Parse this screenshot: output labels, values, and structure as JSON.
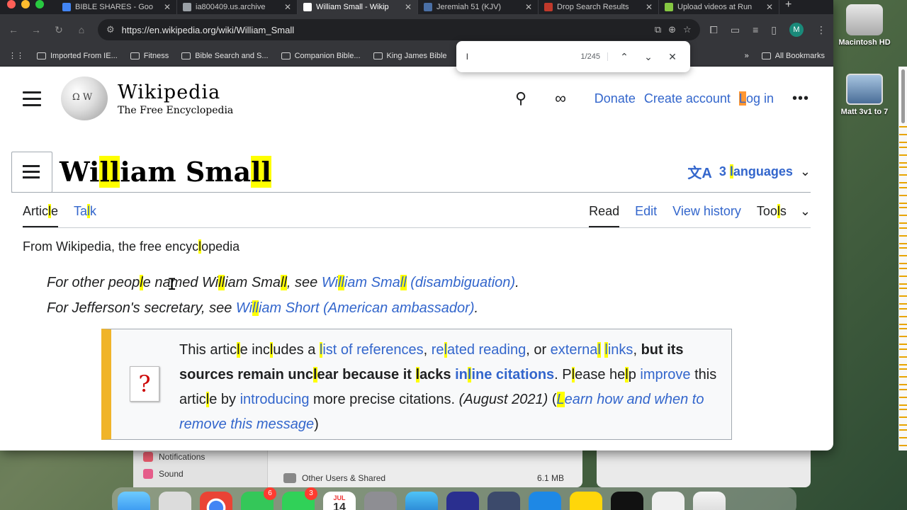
{
  "tabs": [
    {
      "title": "BIBLE SHARES - Goo",
      "favicon_color": "#4285f4",
      "active": false
    },
    {
      "title": "ia800409.us.archive",
      "favicon_color": "#9aa0a6",
      "active": false
    },
    {
      "title": "William Small - Wikip",
      "favicon_color": "#ffffff",
      "active": true
    },
    {
      "title": "Jeremiah 51 (KJV)",
      "favicon_color": "#4a6fa5",
      "active": false
    },
    {
      "title": "Drop Search Results",
      "favicon_color": "#c0392b",
      "active": false
    },
    {
      "title": "Upload videos at Run",
      "favicon_color": "#85c742",
      "active": false
    }
  ],
  "toolbar": {
    "url": "https://en.wikipedia.org/wiki/William_Small",
    "avatar": "M"
  },
  "bookmarks": {
    "items": [
      "Imported From IE...",
      "Fitness",
      "Bible Search and S...",
      "Companion Bible...",
      "King James Bible"
    ],
    "all": "All Bookmarks",
    "more": "»"
  },
  "find": {
    "query": "l",
    "count": "1/245"
  },
  "wiki": {
    "wordmark": "Wikipedia",
    "tagline_logo": "The Free Encyclopedia",
    "donate": "Donate",
    "create_account": "Create account",
    "login_first": "L",
    "login_rest": "og in",
    "title_parts": [
      "Wi",
      "ll",
      "iam Sma",
      "ll"
    ],
    "languages_count": "3 ",
    "languages_l": "l",
    "languages_rest": "anguages",
    "tabs": {
      "article_a": "Artic",
      "article_b": "l",
      "article_c": "e",
      "talk_a": "Ta",
      "talk_b": "l",
      "talk_c": "k",
      "read": "Read",
      "edit": "Edit",
      "history": "View history",
      "tools_a": "Too",
      "tools_b": "l",
      "tools_c": "s"
    },
    "from_a": "From Wikipedia, the free encyc",
    "from_b": "l",
    "from_c": "opedia",
    "hatnote1": {
      "a": "For other peop",
      "b": "l",
      "c": "e named Wi",
      "d": "ll",
      "e": "iam Sma",
      "f": "ll",
      "g": ", see ",
      "link_a": "Wi",
      "link_b": "ll",
      "link_c": "iam Sma",
      "link_d": "ll",
      "link_e": " (disambiguation)",
      "end": "."
    },
    "hatnote2": {
      "a": "For Jefferson's secretary, see ",
      "link_a": "Wi",
      "link_b": "ll",
      "link_c": "iam Short (American ambassador)",
      "end": "."
    },
    "ambox": {
      "icon": "?",
      "t1": "This artic",
      "t1b": "l",
      "t1c": "e inc",
      "t1d": "l",
      "t1e": "udes a ",
      "l1a": "l",
      "l1b": "ist of references",
      "t2": ", ",
      "l2a": "re",
      "l2b": "l",
      "l2c": "ated reading",
      "t3": ", or ",
      "l3a": "externa",
      "l3b": "l",
      "l3c": " ",
      "l3d": "l",
      "l3e": "inks",
      "t4": ", ",
      "b1": "but its sources remain unc",
      "b1b": "l",
      "b1c": "ear because it ",
      "b1d": "l",
      "b1e": "acks ",
      "l4a": "in",
      "l4b": "l",
      "l4c": "ine citations",
      "t5": ". P",
      "t5b": "l",
      "t5c": "ease he",
      "t5d": "l",
      "t5e": "p ",
      "l5": "improve",
      "t6": " this artic",
      "t6b": "l",
      "t6c": "e by ",
      "l6": "introducing",
      "t7": " more precise citations. ",
      "date": "(August 2021)",
      "t8": " (",
      "l7a": "L",
      "l7b": "earn how and when to remove this message",
      "t9": ")"
    }
  },
  "desktop": {
    "icon1": "Macintosh HD",
    "icon2": "Matt 3v1 to 7"
  },
  "syswin": {
    "notifications": "Notifications",
    "sound": "Sound",
    "other_users": "Other Users & Shared",
    "size": "6.1 MB"
  },
  "dock": {
    "badge_messages": "6",
    "badge_facetime": "3",
    "cal_month": "JUL",
    "cal_day": "14"
  },
  "colors": {
    "link": "#3366cc",
    "find_highlight": "#ffff00",
    "find_current": "#ff9632",
    "ambox_stripe": "#f0b429"
  }
}
